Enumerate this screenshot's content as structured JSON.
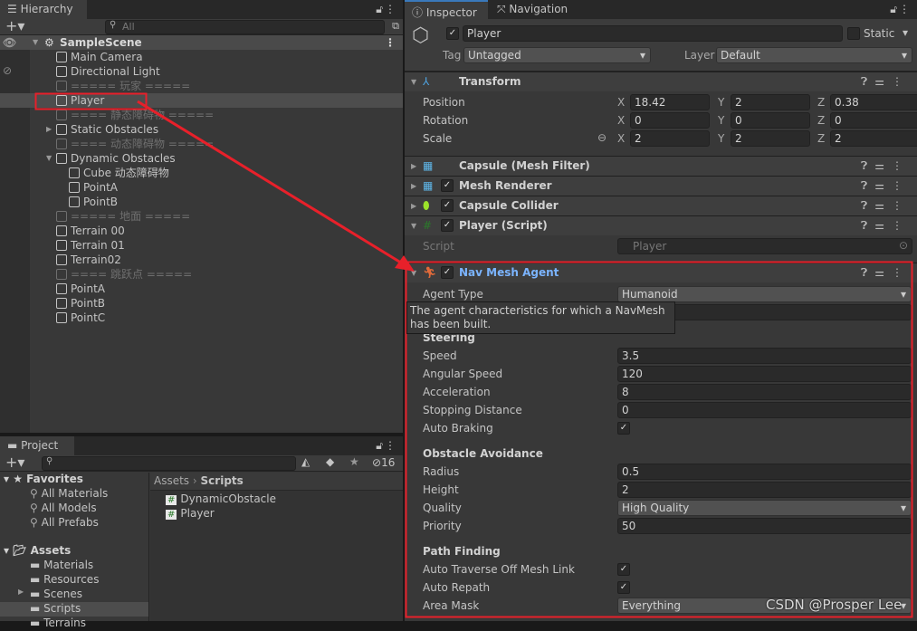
{
  "hierarchy": {
    "tab": "Hierarchy",
    "search_placeholder": "All",
    "scene": "SampleScene",
    "items": [
      {
        "label": "Main Camera",
        "level": 1
      },
      {
        "label": "Directional Light",
        "level": 1
      },
      {
        "label": "===== 玩家 =====",
        "level": 1,
        "dim": true
      },
      {
        "label": "Player",
        "level": 1,
        "selected": true
      },
      {
        "label": "==== 静态障碍物 =====",
        "level": 1,
        "dim": true
      },
      {
        "label": "Static Obstacles",
        "level": 1,
        "arrow": "collapsed"
      },
      {
        "label": "==== 动态障碍物 =====",
        "level": 1,
        "dim": true
      },
      {
        "label": "Dynamic Obstacles",
        "level": 1,
        "arrow": "expanded"
      },
      {
        "label": "Cube 动态障碍物",
        "level": 2
      },
      {
        "label": "PointA",
        "level": 2
      },
      {
        "label": "PointB",
        "level": 2
      },
      {
        "label": "===== 地面 =====",
        "level": 1,
        "dim": true
      },
      {
        "label": "Terrain 00",
        "level": 1
      },
      {
        "label": "Terrain 01",
        "level": 1
      },
      {
        "label": "Terrain02",
        "level": 1
      },
      {
        "label": "==== 跳跃点 =====",
        "level": 1,
        "dim": true
      },
      {
        "label": "PointA",
        "level": 1
      },
      {
        "label": "PointB",
        "level": 1
      },
      {
        "label": "PointC",
        "level": 1
      }
    ]
  },
  "project": {
    "tab": "Project",
    "hidden_count": "16",
    "favorites": "Favorites",
    "fav_items": [
      "All Materials",
      "All Models",
      "All Prefabs"
    ],
    "assets": "Assets",
    "asset_folders": [
      "Materials",
      "Resources",
      "Scenes",
      "Scripts",
      "Terrains"
    ],
    "selected_folder": "Scripts",
    "breadcrumb": [
      "Assets",
      "Scripts"
    ],
    "files": [
      "DynamicObstacle",
      "Player"
    ]
  },
  "inspector": {
    "tabs": [
      "Inspector",
      "Navigation"
    ],
    "object_name": "Player",
    "static_label": "Static",
    "tag_label": "Tag",
    "tag": "Untagged",
    "layer_label": "Layer",
    "layer": "Default",
    "transform": {
      "title": "Transform",
      "rows": [
        {
          "label": "Position",
          "x": "18.42",
          "y": "2",
          "z": "0.38"
        },
        {
          "label": "Rotation",
          "x": "0",
          "y": "0",
          "z": "0"
        },
        {
          "label": "Scale",
          "x": "2",
          "y": "2",
          "z": "2"
        }
      ]
    },
    "components": [
      "Capsule (Mesh Filter)",
      "Mesh Renderer",
      "Capsule Collider",
      "Player (Script)"
    ],
    "script_label": "Script",
    "script_value": "Player",
    "nav": {
      "title": "Nav Mesh Agent",
      "agent_type_label": "Agent Type",
      "agent_type": "Humanoid",
      "tooltip": "The agent characteristics for which a NavMesh has been built.",
      "steering": "Steering",
      "steering_rows": [
        {
          "label": "Speed",
          "value": "3.5"
        },
        {
          "label": "Angular Speed",
          "value": "120"
        },
        {
          "label": "Acceleration",
          "value": "8"
        },
        {
          "label": "Stopping Distance",
          "value": "0"
        },
        {
          "label": "Auto Braking",
          "check": true
        }
      ],
      "obstacle": "Obstacle Avoidance",
      "obstacle_rows": [
        {
          "label": "Radius",
          "value": "0.5"
        },
        {
          "label": "Height",
          "value": "2"
        },
        {
          "label": "Quality",
          "value": "High Quality",
          "drop": true
        },
        {
          "label": "Priority",
          "value": "50"
        }
      ],
      "path": "Path Finding",
      "path_rows": [
        {
          "label": "Auto Traverse Off Mesh Link",
          "check": true
        },
        {
          "label": "Auto Repath",
          "check": true
        },
        {
          "label": "Area Mask",
          "value": "Everything",
          "drop": true
        }
      ]
    }
  },
  "watermark": "CSDN @Prosper Lee",
  "colors": {
    "annotation": "#e8202a",
    "accent": "#7bb4ff",
    "selected": "#4d4d4d"
  }
}
